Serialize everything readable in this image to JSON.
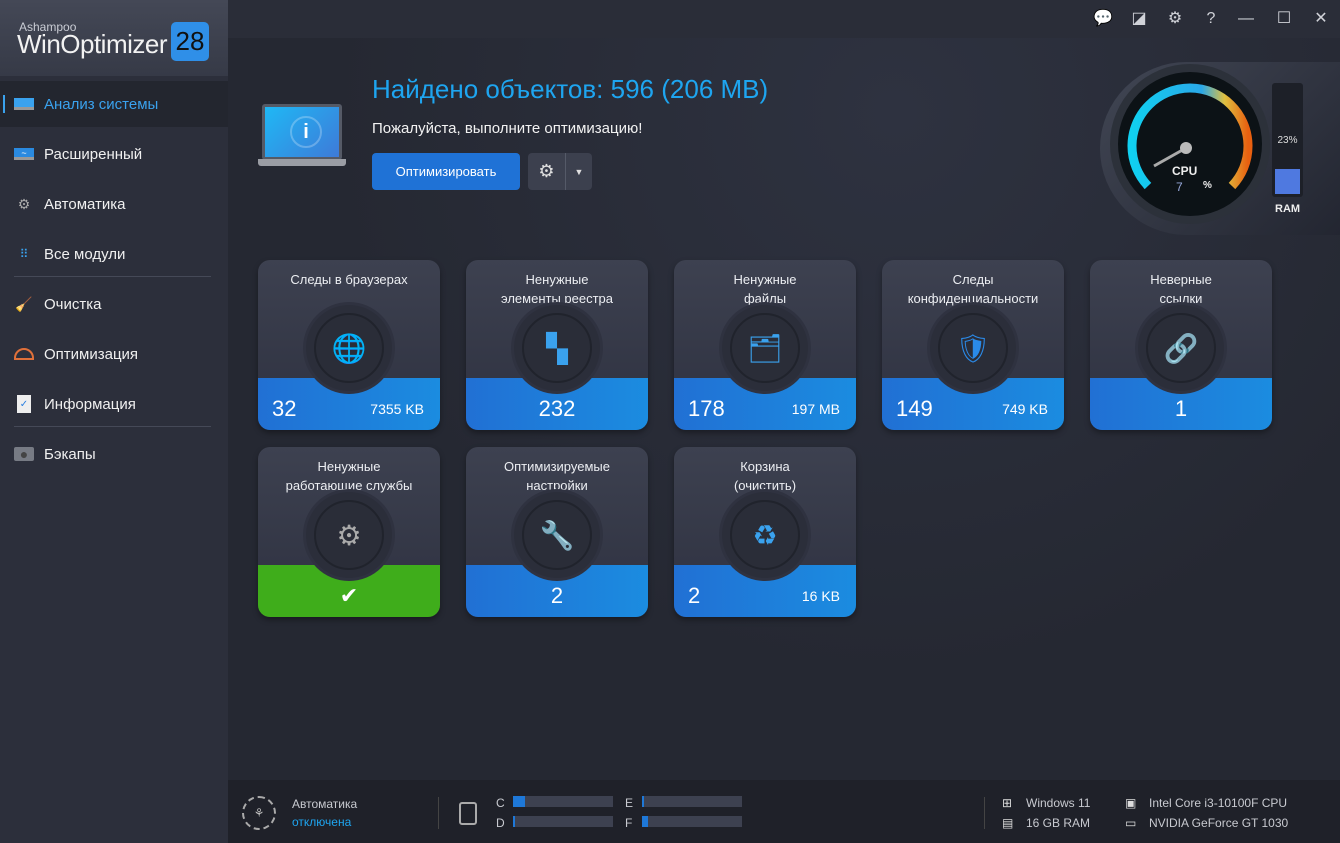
{
  "app": {
    "brand": "Ashampoo",
    "name": "WinOptimizer",
    "version": "28"
  },
  "sidebar": {
    "items": [
      {
        "label": "Анализ системы",
        "icon": "laptop-icon"
      },
      {
        "label": "Расширенный",
        "icon": "monitor-chart-icon"
      },
      {
        "label": "Автоматика",
        "icon": "gear-play-icon"
      },
      {
        "label": "Все модули",
        "icon": "grid-icon"
      },
      {
        "label": "Очистка",
        "icon": "broom-icon"
      },
      {
        "label": "Оптимизация",
        "icon": "speedometer-icon"
      },
      {
        "label": "Информация",
        "icon": "clipboard-icon"
      },
      {
        "label": "Бэкапы",
        "icon": "backup-drive-icon"
      }
    ]
  },
  "header": {
    "headline": "Найдено объектов: 596 (206 MB)",
    "subline": "Пожалуйста, выполните оптимизацию!",
    "optimize_label": "Оптимизировать"
  },
  "gauge": {
    "cpu_label": "CPU",
    "cpu_value": "7",
    "cpu_unit": "%",
    "ram_label": "RAM",
    "ram_value": "23%",
    "ram_fraction": 0.23
  },
  "cards": [
    {
      "title": "Следы в браузерах",
      "count": "32",
      "size": "7355 KB",
      "icon": "globe-cursor-icon"
    },
    {
      "title": "Ненужные\nэлементы реестра",
      "count": "232",
      "size": "",
      "icon": "registry-blocks-icon"
    },
    {
      "title": "Ненужные\nфайлы",
      "count": "178",
      "size": "197 MB",
      "icon": "file-tray-icon"
    },
    {
      "title": "Следы\nконфиденциальности",
      "count": "149",
      "size": "749 KB",
      "icon": "shield-user-icon"
    },
    {
      "title": "Неверные\nссылки",
      "count": "1",
      "size": "",
      "icon": "broken-link-icon"
    },
    {
      "title": "Ненужные\nработающие службы",
      "count": "✔",
      "size": "",
      "icon": "gears-icon",
      "status": "ok"
    },
    {
      "title": "Оптимизируемые\nнастройки",
      "count": "2",
      "size": "",
      "icon": "wrench-icon"
    },
    {
      "title": "Корзина\n(очистить)",
      "count": "2",
      "size": "16 KB",
      "icon": "recycle-bin-icon"
    }
  ],
  "bottom": {
    "automation_label": "Автоматика",
    "automation_status": "отключена",
    "drives": [
      {
        "letter": "C",
        "fill": 0.12
      },
      {
        "letter": "D",
        "fill": 0.02
      },
      {
        "letter": "E",
        "fill": 0.01
      },
      {
        "letter": "F",
        "fill": 0.06
      }
    ],
    "os": "Windows 11",
    "ram": "16 GB RAM",
    "cpu": "Intel Core i3-10100F CPU",
    "gpu": "NVIDIA GeForce GT 1030"
  },
  "colors": {
    "accent": "#1ea5f0",
    "button": "#1f72d6",
    "band": "#2170d4",
    "ok": "#3fad1b"
  }
}
